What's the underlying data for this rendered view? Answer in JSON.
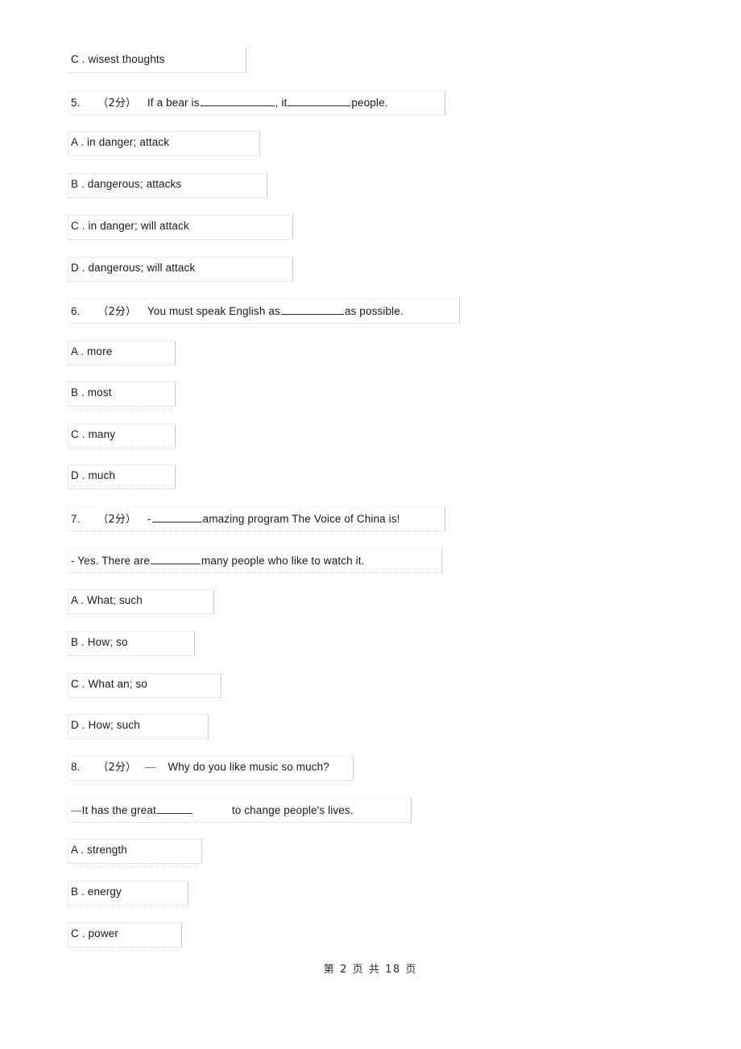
{
  "document": {
    "type": "exam-worksheet",
    "language": "zh-CN/en",
    "page_background": "#ffffff",
    "text_color": "#1a1a1a",
    "border_color": "#d9d9dd"
  },
  "items": [
    {
      "id": "opt-4c",
      "kind": "option",
      "text": "C . wisest thoughts"
    },
    {
      "id": "q5-stem",
      "kind": "stem",
      "number": "5.",
      "marks": "（2分）",
      "pre": "If a bear is ",
      "mid": ", it ",
      "post": " people."
    },
    {
      "id": "q5-a",
      "kind": "option",
      "text": "A . in danger; attack"
    },
    {
      "id": "q5-b",
      "kind": "option",
      "text": "B . dangerous; attacks"
    },
    {
      "id": "q5-c",
      "kind": "option",
      "text": "C . in danger; will attack"
    },
    {
      "id": "q5-d",
      "kind": "option",
      "text": "D . dangerous; will attack"
    },
    {
      "id": "q6-stem",
      "kind": "stem",
      "number": "6.",
      "marks": "（2分）",
      "pre": "You must speak English as",
      "post": " as possible."
    },
    {
      "id": "q6-a",
      "kind": "option",
      "text": "A . more"
    },
    {
      "id": "q6-b",
      "kind": "option",
      "text": "B . most"
    },
    {
      "id": "q6-c",
      "kind": "option",
      "text": "C . many"
    },
    {
      "id": "q6-d",
      "kind": "option",
      "text": "D . much"
    },
    {
      "id": "q7-stem",
      "kind": "stem",
      "number": "7.",
      "marks": "（2分）",
      "pre": "- ",
      "post": " amazing program The Voice of China is!"
    },
    {
      "id": "q7-stem2",
      "kind": "stem-cont",
      "pre": "- Yes. There are ",
      "post": " many people who like to watch it."
    },
    {
      "id": "q7-a",
      "kind": "option",
      "text": "A . What; such"
    },
    {
      "id": "q7-b",
      "kind": "option",
      "text": "B . How; so"
    },
    {
      "id": "q7-c",
      "kind": "option",
      "text": "C . What an; so"
    },
    {
      "id": "q7-d",
      "kind": "option",
      "text": "D . How; such"
    },
    {
      "id": "q8-stem",
      "kind": "stem",
      "number": "8.",
      "marks": "（2分）",
      "dash": "—",
      "post": "Why do you like music so much?"
    },
    {
      "id": "q8-stem2",
      "kind": "stem-cont",
      "dash": "—",
      "pre": " It has the great",
      "post": "to change people's lives."
    },
    {
      "id": "q8-a",
      "kind": "option",
      "text": "A . strength"
    },
    {
      "id": "q8-b",
      "kind": "option",
      "text": "B . energy"
    },
    {
      "id": "q8-c",
      "kind": "option",
      "text": "C . power"
    }
  ],
  "footer": {
    "text": "第 2 页 共 18 页",
    "page_number": "2",
    "total_pages": "18"
  }
}
